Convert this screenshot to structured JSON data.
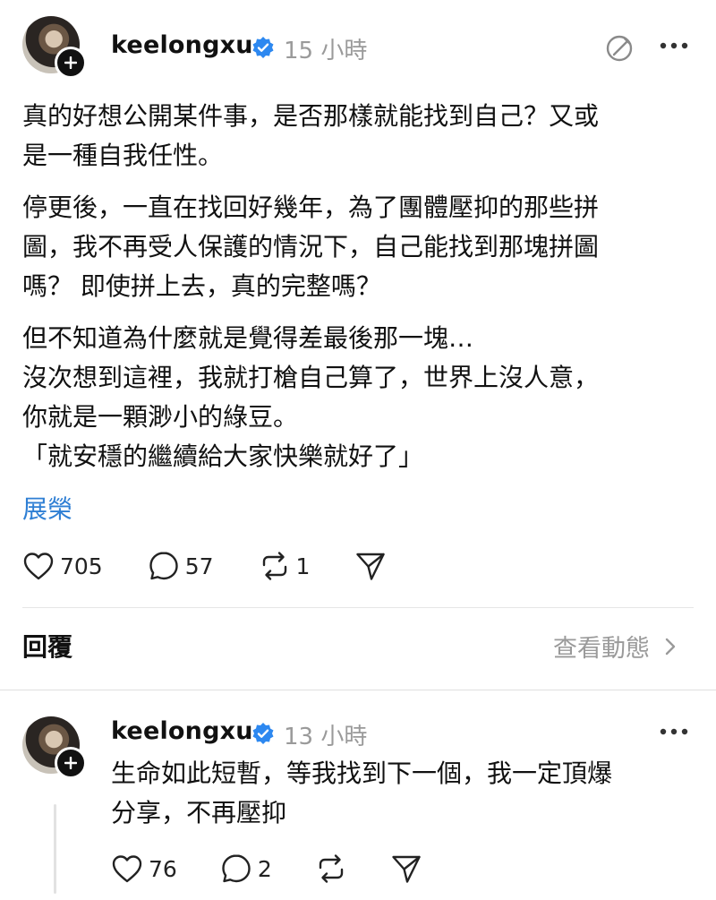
{
  "post": {
    "username": "keelongxu",
    "time": "15 小時",
    "paragraphs": [
      [
        "真的好想公開某件事，是否那樣就能找到自己？又或",
        "是一種自我任性。"
      ],
      [
        "停更後，一直在找回好幾年，為了團體壓抑的那些拼",
        "圖，我不再受人保護的情況下，自己能找到那塊拼圖",
        "嗎？ 即使拼上去，真的完整嗎？"
      ],
      [
        "但不知道為什麼就是覺得差最後那一塊…",
        "沒次想到這裡，我就打槍自己算了，世界上沒人意，",
        "你就是一顆渺小的綠豆。",
        "「就安穩的繼續給大家快樂就好了」"
      ]
    ],
    "hashtag": "展榮",
    "likes": "705",
    "comments": "57",
    "reposts": "1"
  },
  "replies_header": {
    "title": "回覆",
    "view_activity": "查看動態"
  },
  "reply": {
    "username": "keelongxu",
    "time": "13 小時",
    "lines": [
      "生命如此短暫，等我找到下一個，我一定頂爆",
      "分享，不再壓抑"
    ],
    "likes": "76",
    "comments": "2"
  },
  "icons": {
    "verified_color": "#2d88f0",
    "link_color": "#2f7fd4"
  }
}
